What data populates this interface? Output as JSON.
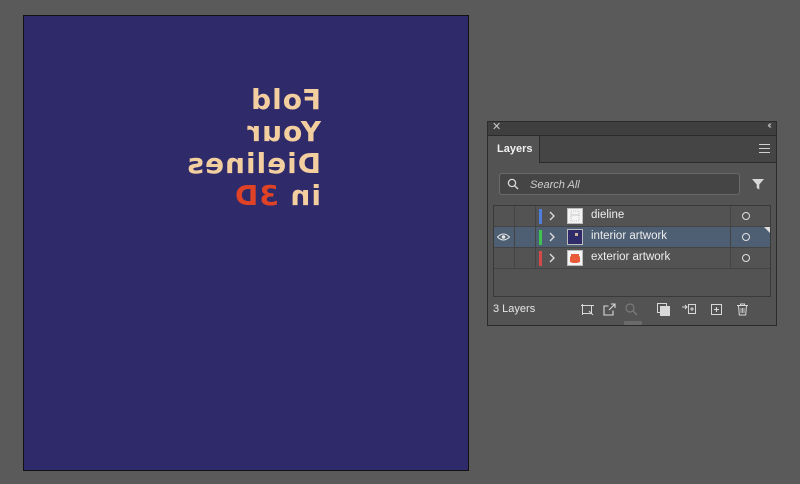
{
  "artboard": {
    "background": "#2f2b6b",
    "lines": [
      "Fold",
      "Your",
      "Dielines",
      "in"
    ],
    "accent_word": "3D",
    "text_color": "#f3cfa0",
    "accent_color": "#e04226",
    "mirrored": true
  },
  "panel": {
    "tab_label": "Layers",
    "search": {
      "placeholder": "Search All",
      "value": ""
    },
    "layers": [
      {
        "name": "dieline",
        "visible": false,
        "color": "#4f7ddc",
        "thumb": "white",
        "selected": false
      },
      {
        "name": "interior artwork",
        "visible": true,
        "color": "#3ec44e",
        "thumb": "navy",
        "selected": true
      },
      {
        "name": "exterior artwork",
        "visible": false,
        "color": "#d44a4a",
        "thumb": "red",
        "selected": false
      }
    ],
    "footer": {
      "count_label": "3 Layers",
      "icons": [
        "collect-for-export-icon",
        "export-icon",
        "locate-object-icon",
        "clipping-mask-icon",
        "new-sublayer-icon",
        "new-layer-icon",
        "delete-icon"
      ]
    }
  }
}
